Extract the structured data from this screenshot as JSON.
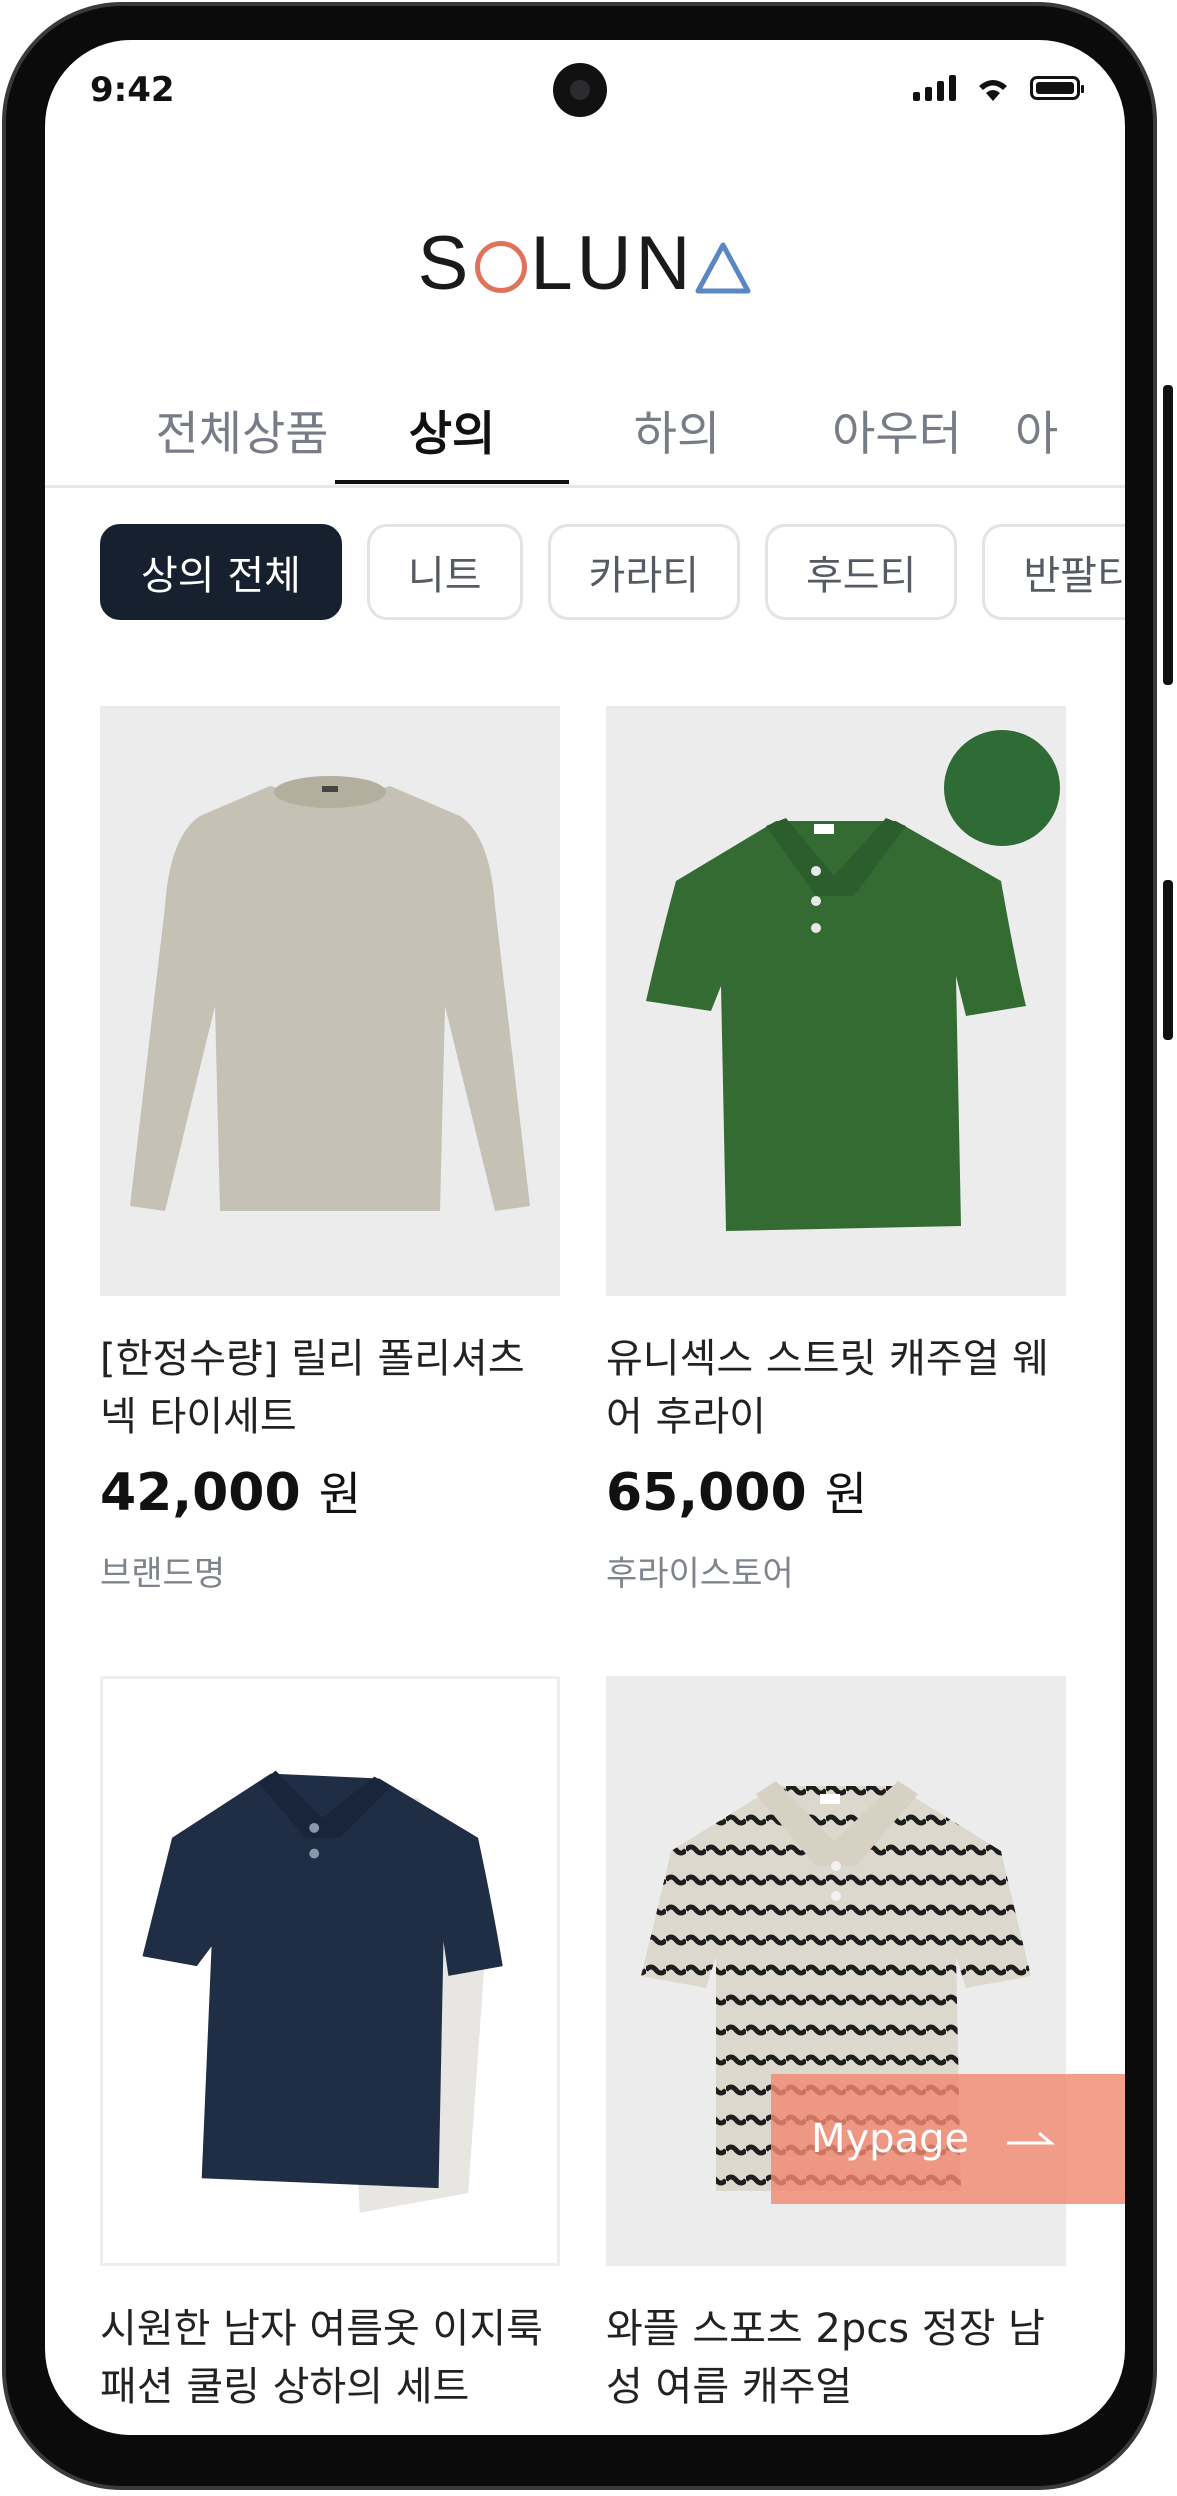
{
  "status": {
    "time": "9:42"
  },
  "brand_logo": {
    "before": "S",
    "after": "LUN"
  },
  "tabs": [
    {
      "label": "전체상품"
    },
    {
      "label": "상의"
    },
    {
      "label": "하의"
    },
    {
      "label": "아우터"
    },
    {
      "label": "아"
    }
  ],
  "chips": [
    {
      "label": "상의 전체"
    },
    {
      "label": "니트"
    },
    {
      "label": "카라티"
    },
    {
      "label": "후드티"
    },
    {
      "label": "반팔티"
    }
  ],
  "products": [
    {
      "name": "[한정수량] 릴리 폴리셔츠 넥 타이세트",
      "price": "42,000",
      "unit": "원",
      "brand": "브랜드명"
    },
    {
      "name": "유니섹스 스트릿 캐주얼 웨어 후라이",
      "price": "65,000",
      "unit": "원",
      "brand": "후라이스토어"
    },
    {
      "name": "시원한 남자 여름옷 이지룩 패션 쿨링 상하의 세트"
    },
    {
      "name": "와플 스포츠 2pcs 정장 남성 여름 캐주얼"
    }
  ],
  "mypage": {
    "label": "Mypage"
  },
  "colors": {
    "accent": "#e0725c",
    "logo_triangle": "#5a86c4",
    "chip_active": "#16202e",
    "mypage": "#f28973"
  }
}
